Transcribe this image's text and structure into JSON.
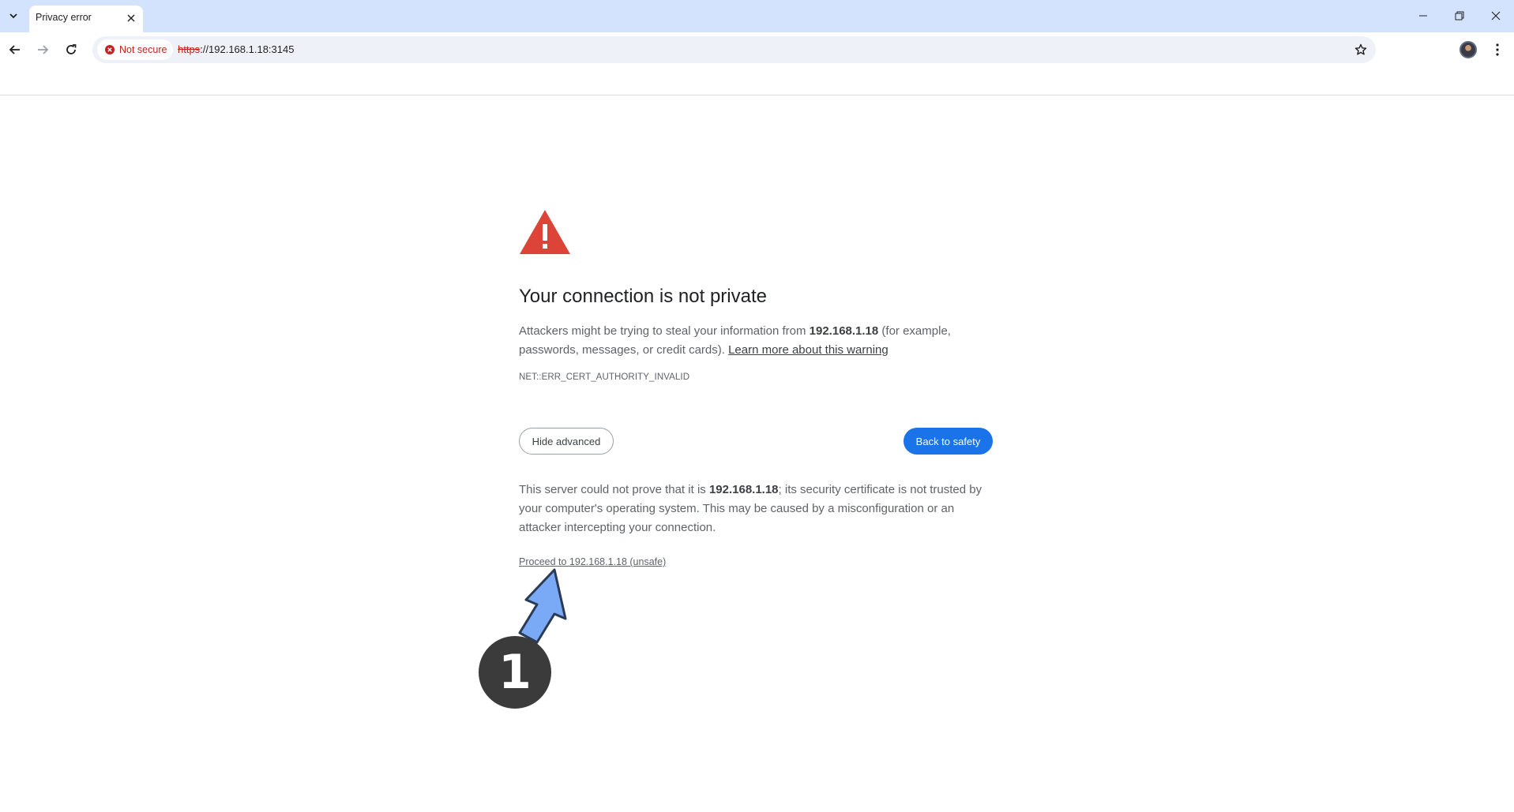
{
  "browser": {
    "tab": {
      "title": "Privacy error",
      "close_icon": "close-icon"
    },
    "tab_search_icon": "chevron-down-icon",
    "window_controls": [
      "minimize-icon",
      "restore-icon",
      "close-icon"
    ],
    "toolbar": {
      "back_icon": "arrow-left-icon",
      "forward_icon": "arrow-right-icon",
      "reload_icon": "reload-icon",
      "security_chip": {
        "icon": "error-circle-icon",
        "label": "Not secure",
        "color": "#c5221f"
      },
      "url": {
        "scheme": "https",
        "rest": "://192.168.1.18:3145"
      },
      "bookmark_icon": "star-icon",
      "menu_icon": "kebab-menu-icon"
    }
  },
  "interstitial": {
    "heading": "Your connection is not private",
    "desc_pre": "Attackers might be trying to steal your information from ",
    "desc_host": "192.168.1.18",
    "desc_post": " (for example, passwords, messages, or credit cards). ",
    "learn_more": "Learn more about this warning",
    "error_code": "NET::ERR_CERT_AUTHORITY_INVALID",
    "hide_advanced": "Hide advanced",
    "back_to_safety": "Back to safety",
    "details_pre": "This server could not prove that it is ",
    "details_host": "192.168.1.18",
    "details_post": "; its security certificate is not trusted by your computer's operating system. This may be caused by a misconfiguration or an attacker intercepting your connection.",
    "proceed_link": "Proceed to 192.168.1.18 (unsafe)",
    "accent_color": "#1a73e8",
    "warning_color": "#db4437"
  },
  "annotation": {
    "step_number": "1",
    "arrow_color": "#7aaaf5"
  }
}
